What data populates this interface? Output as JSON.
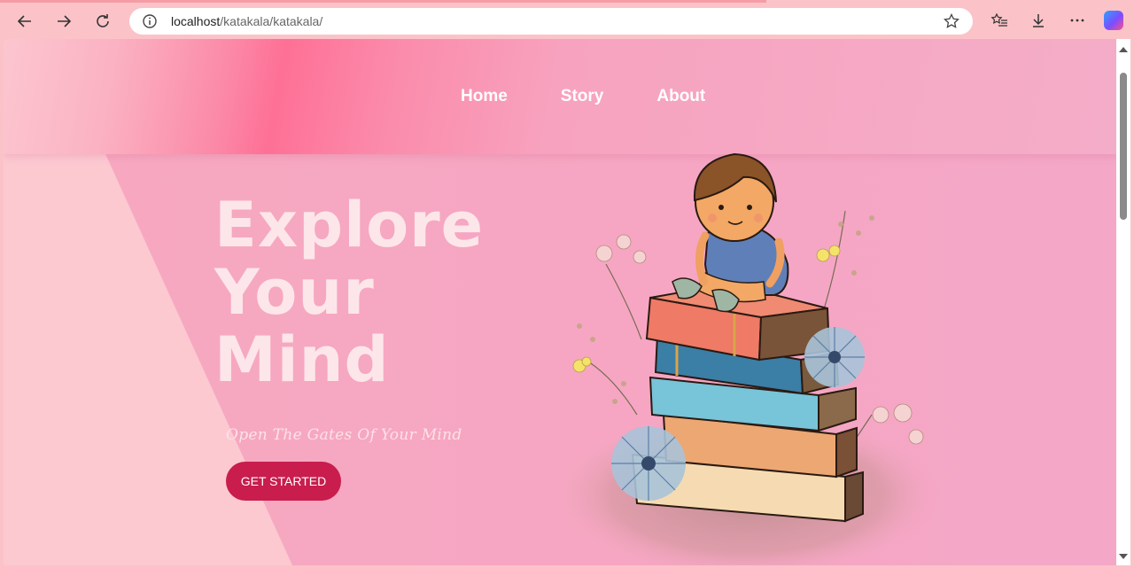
{
  "browser": {
    "url_host": "localhost",
    "url_path": "/katakala/katakala/"
  },
  "nav": {
    "items": [
      "Home",
      "Story",
      "About"
    ]
  },
  "hero": {
    "title_lines": [
      "Explore",
      "Your",
      "Mind"
    ],
    "subtitle": "Open The Gates Of Your Mind",
    "cta_label": "GET STARTED"
  },
  "colors": {
    "accent": "#c81d4d",
    "page_bg": "#f5a8bf",
    "browser_bg": "#fbc3c8"
  }
}
